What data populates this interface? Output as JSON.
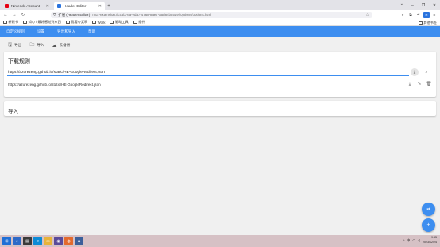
{
  "browser": {
    "tabs": [
      {
        "title": "Nintendo Account",
        "favicon_color": "#e60012",
        "active": false
      },
      {
        "title": "Header Editor",
        "favicon_color": "#2a73de",
        "active": true
      }
    ],
    "new_tab": "+",
    "url_prefix": "扩展 (Header Editor)",
    "url": "moz-extension://cc6b7ea-eda7-4768-8ae7-a5d84b55d9f/options/options.html",
    "star": "☆"
  },
  "bookmarks": {
    "items": [
      "新建书",
      "知心 / 最好感觉到东西",
      "我要夸奖啊",
      "Work",
      "驱动工具",
      "插件"
    ],
    "right_label": "其他书签"
  },
  "appbar": {
    "tabs": [
      {
        "label": "自定义规则",
        "active": false
      },
      {
        "label": "设置",
        "active": false
      },
      {
        "label": "导出和导入",
        "active": true
      },
      {
        "label": "帮助",
        "active": false
      }
    ],
    "color": "#3d8ef0"
  },
  "actions": {
    "export": "导出",
    "import": "导入",
    "cloud": "云备份"
  },
  "download": {
    "heading": "下载规则",
    "input_value": "https://azurezeng.github.io/static/HE-GoogleRedirect.json",
    "rule_url": "https://azurezeng.github.io/static/HE-GoogleRedirect.json"
  },
  "import": {
    "heading": "导入"
  },
  "taskbar": {
    "tray_lang": "中",
    "time": "9:55",
    "date": "2023/12/24"
  }
}
